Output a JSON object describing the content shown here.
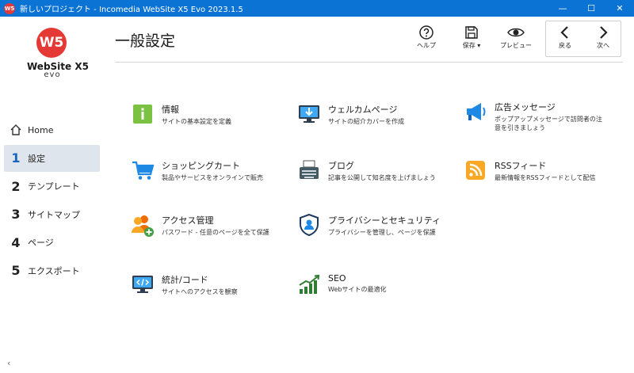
{
  "window": {
    "app_icon_text": "W5",
    "title": "新しいプロジェクト - Incomedia WebSite X5 Evo 2023.1.5",
    "minimize": "—",
    "maximize": "☐",
    "close": "✕"
  },
  "logo": {
    "mark": "W5",
    "name": "WebSite X5",
    "sub": "evo"
  },
  "sidebar": {
    "items": [
      {
        "num": "",
        "label": "Home"
      },
      {
        "num": "1",
        "label": "設定"
      },
      {
        "num": "2",
        "label": "テンプレート"
      },
      {
        "num": "3",
        "label": "サイトマップ"
      },
      {
        "num": "4",
        "label": "ページ"
      },
      {
        "num": "5",
        "label": "エクスポート"
      }
    ],
    "collapse": "‹"
  },
  "header": {
    "title": "一般設定",
    "help": "ヘルプ",
    "save": "保存",
    "preview": "プレビュー",
    "back": "戻る",
    "next": "次へ"
  },
  "grid": [
    {
      "title": "情報",
      "desc": "サイトの基本設定を定義",
      "icon": "info-icon"
    },
    {
      "title": "ウェルカムページ",
      "desc": "サイトの紹介カバーを作成",
      "icon": "monitor-icon"
    },
    {
      "title": "広告メッセージ",
      "desc": "ポップアップメッセージで訪問者の注意を引きましょう",
      "icon": "megaphone-icon"
    },
    {
      "title": "ショッピングカート",
      "desc": "製品やサービスをオンラインで販売",
      "icon": "cart-icon"
    },
    {
      "title": "ブログ",
      "desc": "記事を公開して知名度を上げましょう",
      "icon": "typewriter-icon"
    },
    {
      "title": "RSSフィード",
      "desc": "最新情報をRSSフィードとして配信",
      "icon": "rss-icon"
    },
    {
      "title": "アクセス管理",
      "desc": "パスワード - 任意のページを全て保護",
      "icon": "users-icon"
    },
    {
      "title": "プライバシーとセキュリティ",
      "desc": "プライバシーを管理し、ページを保護",
      "icon": "shield-icon"
    },
    {
      "title": "統計/コード",
      "desc": "サイトへのアクセスを観察",
      "icon": "code-monitor-icon"
    },
    {
      "title": "SEO",
      "desc": "Webサイトの最適化",
      "icon": "chart-icon"
    }
  ]
}
